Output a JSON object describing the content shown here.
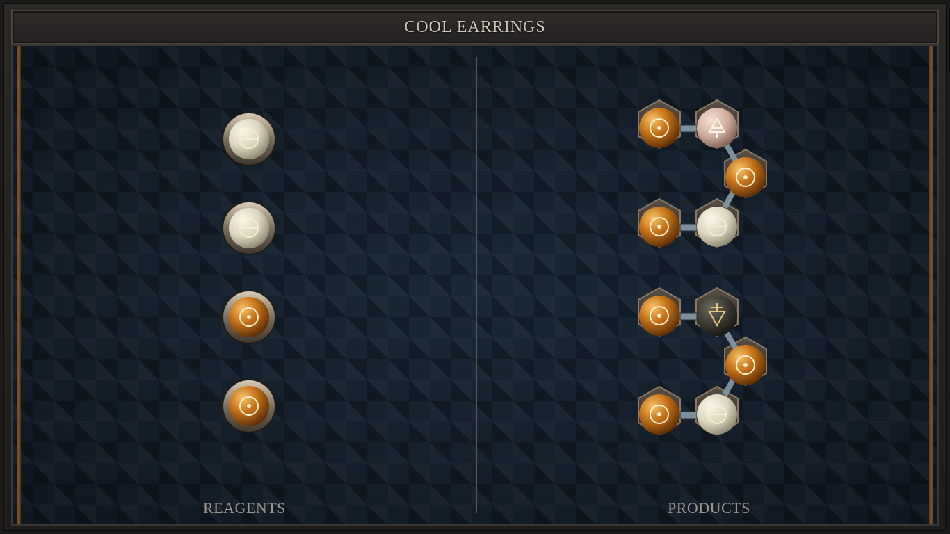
{
  "title": "COOL EARRINGS",
  "sections": {
    "reagents_label": "REAGENTS",
    "products_label": "PRODUCTS"
  },
  "reagents": [
    {
      "element": "salt",
      "symbol": "θ",
      "color": "#e7e1cc"
    },
    {
      "element": "salt",
      "symbol": "θ",
      "color": "#e7e1cc"
    },
    {
      "element": "gold",
      "symbol": "☉",
      "color": "#c8751a"
    },
    {
      "element": "gold",
      "symbol": "☉",
      "color": "#c8751a"
    }
  ],
  "products": [
    {
      "name": "product-1",
      "atoms": [
        {
          "element": "gold",
          "symbol": "☉"
        },
        {
          "element": "air",
          "symbol": "🜁"
        },
        {
          "element": "gold",
          "symbol": "☉"
        },
        {
          "element": "salt",
          "symbol": "θ"
        },
        {
          "element": "gold",
          "symbol": "☉"
        }
      ]
    },
    {
      "name": "product-2",
      "atoms": [
        {
          "element": "gold",
          "symbol": "☉"
        },
        {
          "element": "earth",
          "symbol": "🜃"
        },
        {
          "element": "gold",
          "symbol": "☉"
        },
        {
          "element": "salt",
          "symbol": "θ"
        },
        {
          "element": "gold",
          "symbol": "☉"
        }
      ]
    }
  ],
  "colors": {
    "gold": "#c8751a",
    "salt": "#e7e1cc",
    "air": "#d7b7a8",
    "earth": "#3b3a33",
    "rail": "#8a5a2e"
  }
}
